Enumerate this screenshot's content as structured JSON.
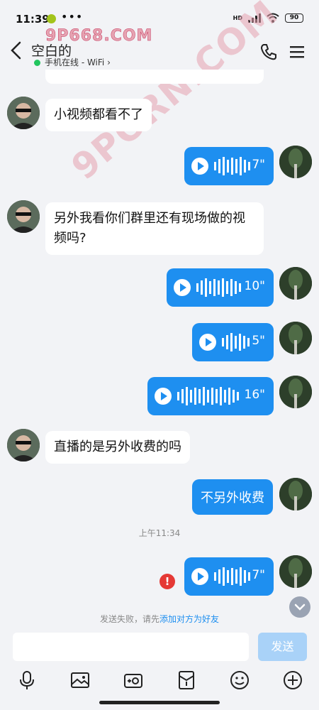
{
  "status_bar": {
    "time": "11:39",
    "more": "•••",
    "hd": "HD",
    "battery": "90"
  },
  "header": {
    "contact_name": "空白的",
    "online_status": "手机在线 - WiFi ›"
  },
  "watermarks": {
    "top": "9P668.COM",
    "diagonal": "9PORN.COM"
  },
  "messages": [
    {
      "side": "left",
      "type": "text",
      "text": "小视频都看不了"
    },
    {
      "side": "right",
      "type": "voice",
      "duration": "7\""
    },
    {
      "side": "left",
      "type": "text",
      "text": "另外我看你们群里还有现场做的视频吗?"
    },
    {
      "side": "right",
      "type": "voice",
      "duration": "10\""
    },
    {
      "side": "right",
      "type": "voice",
      "duration": "5\""
    },
    {
      "side": "right",
      "type": "voice",
      "duration": "16\""
    },
    {
      "side": "left",
      "type": "text",
      "text": "直播的是另外收费的吗"
    },
    {
      "side": "right",
      "type": "text",
      "text": "不另外收费"
    },
    {
      "side": "right",
      "type": "voice",
      "duration": "7\"",
      "failed": true
    }
  ],
  "time_separator": "上午11:34",
  "fail_notice": {
    "prefix": "发送失败，请先",
    "link": "添加对方为好友"
  },
  "input": {
    "placeholder": "",
    "send_label": "发送"
  },
  "colors": {
    "accent": "#1e8ff0",
    "online": "#22c55e",
    "error": "#e53935"
  }
}
